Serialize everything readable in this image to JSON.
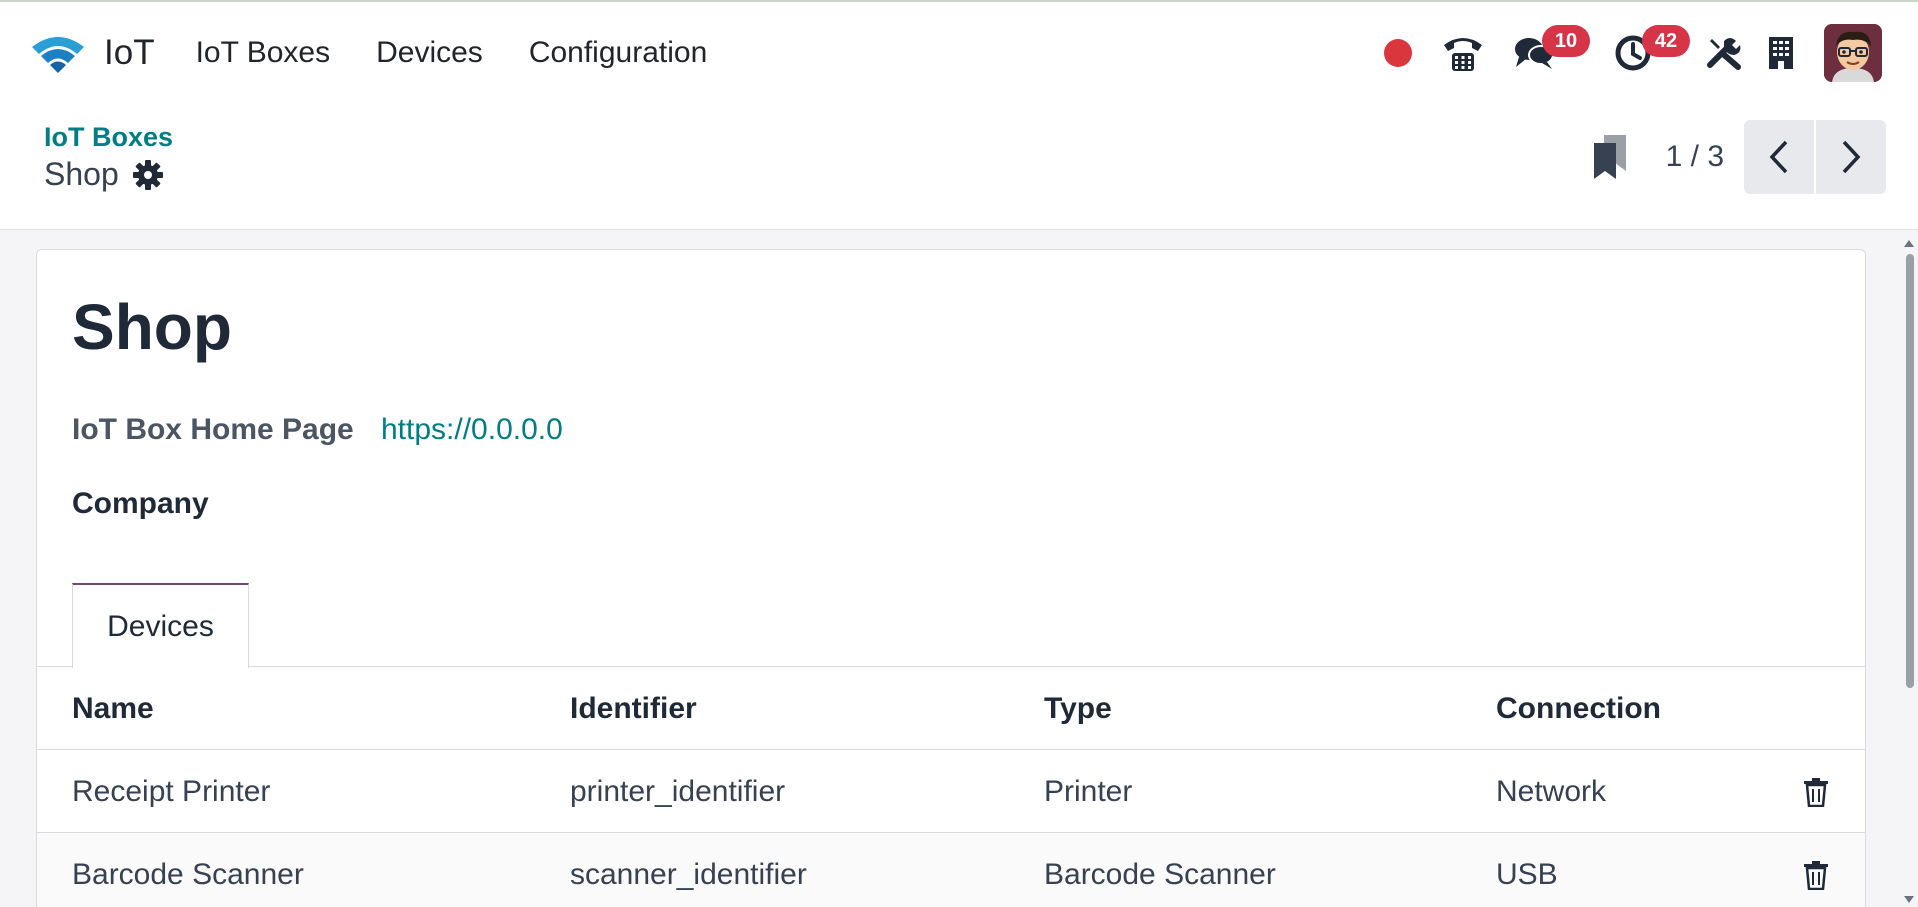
{
  "navbar": {
    "app_name": "IoT",
    "menu": [
      "IoT Boxes",
      "Devices",
      "Configuration"
    ],
    "badges": {
      "messages": "10",
      "activities": "42"
    },
    "icons": [
      "recording-dot-icon",
      "phone-icon",
      "chat-icon",
      "clock-icon",
      "tools-icon",
      "building-icon",
      "user-avatar"
    ]
  },
  "control": {
    "breadcrumb": "IoT Boxes",
    "record_name": "Shop",
    "pager": "1 / 3"
  },
  "form": {
    "title": "Shop",
    "home_page_label": "IoT Box Home Page",
    "home_page_value": "https://0.0.0.0",
    "company_label": "Company",
    "tab_label": "Devices"
  },
  "devices_table": {
    "columns": [
      "Name",
      "Identifier",
      "Type",
      "Connection"
    ],
    "rows": [
      {
        "name": "Receipt Printer",
        "identifier": "printer_identifier",
        "type": "Printer",
        "connection": "Network"
      },
      {
        "name": "Barcode Scanner",
        "identifier": "scanner_identifier",
        "type": "Barcode Scanner",
        "connection": "USB"
      }
    ]
  },
  "colors": {
    "link": "#017e84",
    "tab_accent": "#714b67",
    "badge": "#d63548",
    "record_dot": "#d9363e"
  }
}
